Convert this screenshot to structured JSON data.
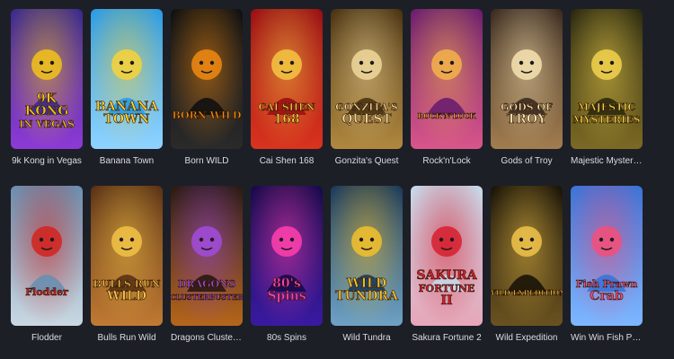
{
  "games": [
    {
      "name": "9k Kong in Vegas",
      "art_text": [
        "9K",
        "KONG",
        "IN VEGAS"
      ],
      "icon": "gorilla-icon",
      "colors": [
        "#3b2a8c",
        "#8d3ad6",
        "#f2c21b"
      ]
    },
    {
      "name": "Banana Town",
      "art_text": [
        "BANANA",
        "TOWN"
      ],
      "icon": "people-icon",
      "colors": [
        "#2a9be6",
        "#8fd3ff",
        "#f7d23a"
      ]
    },
    {
      "name": "Born WILD",
      "art_text": [
        "BORN WILD"
      ],
      "icon": "badge-icon",
      "colors": [
        "#111111",
        "#2a2a2a",
        "#f08a12"
      ]
    },
    {
      "name": "Cai Shen 168",
      "art_text": [
        "CAI SHEN",
        "168"
      ],
      "icon": "deity-icon",
      "colors": [
        "#9a0f14",
        "#d8341e",
        "#f5c542"
      ]
    },
    {
      "name": "Gonzita's Quest",
      "art_text": [
        "GONZITA'S",
        "QUEST"
      ],
      "icon": "explorer-icon",
      "colors": [
        "#4a3312",
        "#b0883f",
        "#f0d79a"
      ]
    },
    {
      "name": "Rock'n'Lock",
      "art_text": [
        "ROCK'N'LOCK"
      ],
      "icon": "rocker-icon",
      "colors": [
        "#6a1d6e",
        "#d9568a",
        "#f4b24a"
      ]
    },
    {
      "name": "Gods of Troy",
      "art_text": [
        "GODS OF",
        "TROY"
      ],
      "icon": "goddess-icon",
      "colors": [
        "#3b2b20",
        "#a27d50",
        "#f6e2b0"
      ]
    },
    {
      "name": "Majestic Mysterie...",
      "art_text": [
        "MAJESTIC",
        "MYSTERIES"
      ],
      "icon": "treasure-chest-icon",
      "colors": [
        "#2b2a10",
        "#7b6a24",
        "#f2d24e"
      ]
    },
    {
      "name": "Flodder",
      "art_text": [
        "Flodder"
      ],
      "icon": "family-icon",
      "colors": [
        "#6a8fb0",
        "#c9d8e2",
        "#d2231e"
      ]
    },
    {
      "name": "Bulls Run Wild",
      "art_text": [
        "BULLS RUN",
        "WILD"
      ],
      "icon": "matador-icon",
      "colors": [
        "#5a3216",
        "#c07a33",
        "#f2c246"
      ]
    },
    {
      "name": "Dragons Clusterbu...",
      "art_text": [
        "DRAGONS",
        "CLUSTERBUSTER"
      ],
      "icon": "dragon-egg-icon",
      "colors": [
        "#2a1a12",
        "#b5661c",
        "#a24bdc"
      ]
    },
    {
      "name": "80s Spins",
      "art_text": [
        "80's",
        "Spins"
      ],
      "icon": "neon-star-icon",
      "colors": [
        "#170a4a",
        "#3a1aa0",
        "#ff3fae"
      ]
    },
    {
      "name": "Wild Tundra",
      "art_text": [
        "WILD",
        "TUNDRA"
      ],
      "icon": "mammoth-icon",
      "colors": [
        "#1c3b5a",
        "#6fa2c4",
        "#f2c02c"
      ]
    },
    {
      "name": "Sakura Fortune 2",
      "art_text": [
        "SAKURA",
        "FORTUNE",
        "II"
      ],
      "icon": "geisha-icon",
      "colors": [
        "#c7d9ea",
        "#e6a7b9",
        "#d61f2e"
      ]
    },
    {
      "name": "Wild Expedition",
      "art_text": [
        "WILD EXPEDITION"
      ],
      "icon": "explorer-woman-icon",
      "colors": [
        "#1a1408",
        "#6a5220",
        "#f0c34a"
      ]
    },
    {
      "name": "Win Win Fish Praw...",
      "art_text": [
        "Fish Prawn",
        "Crab"
      ],
      "icon": "crab-icon",
      "colors": [
        "#3a74d8",
        "#7fb6ff",
        "#f24f7a"
      ]
    }
  ]
}
